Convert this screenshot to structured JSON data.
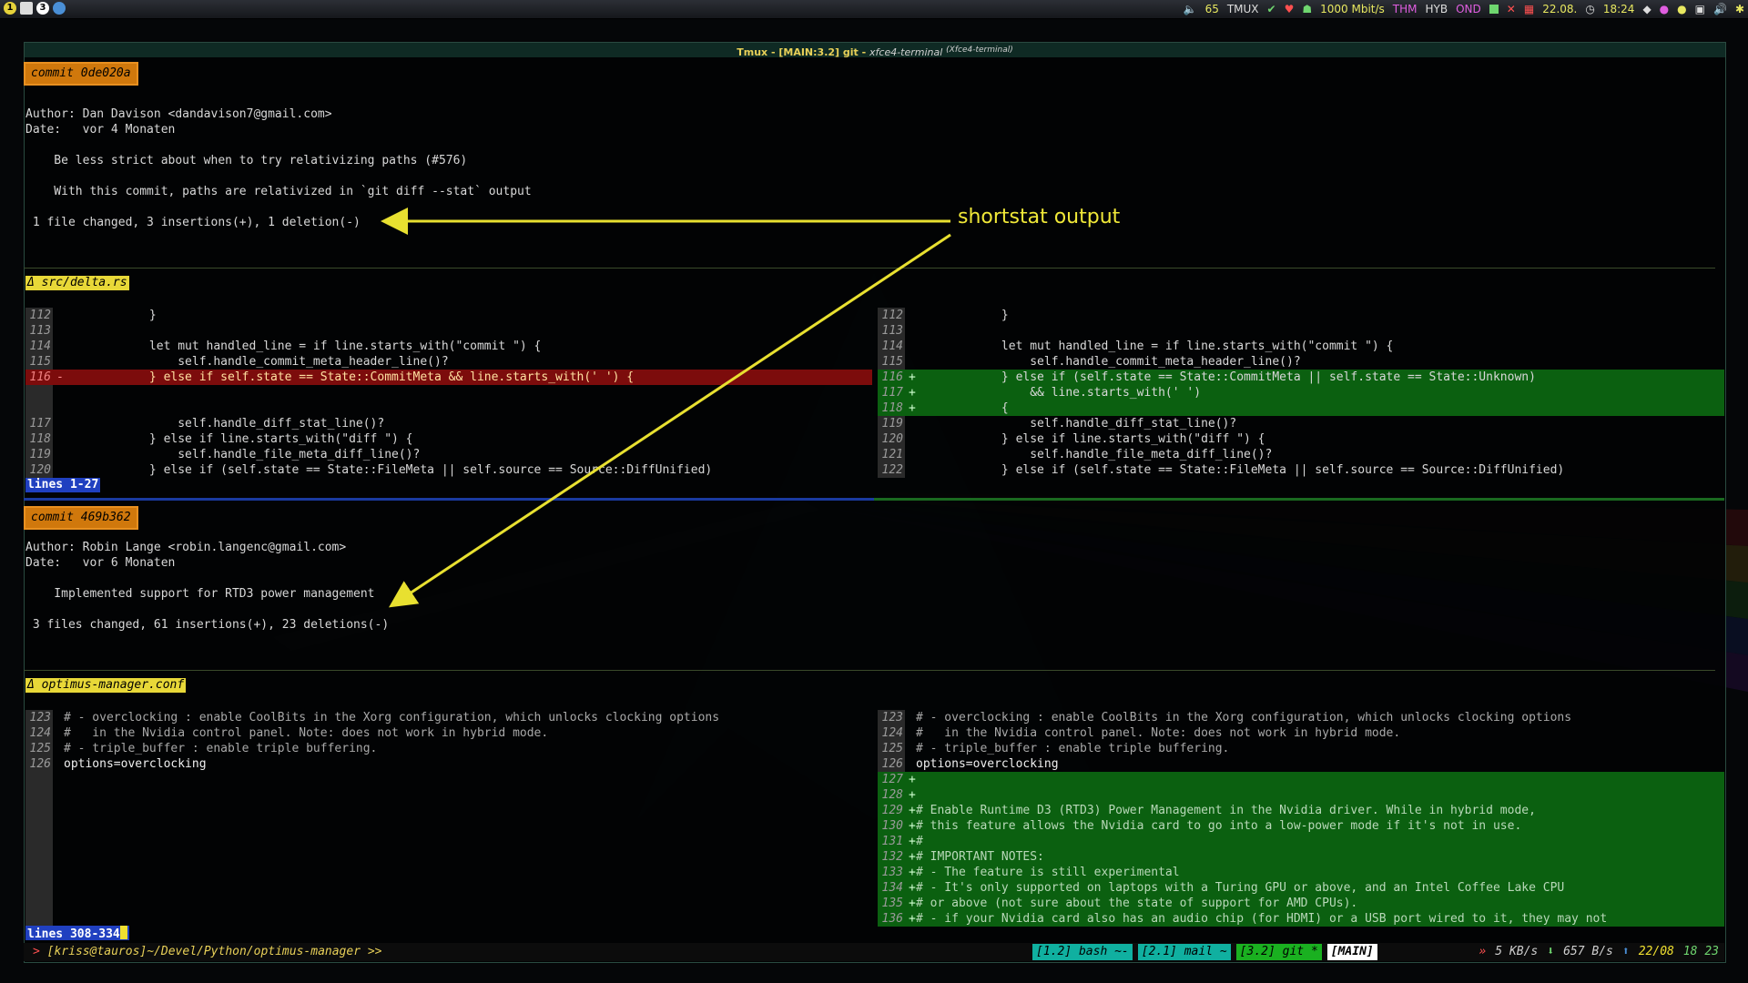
{
  "panel": {
    "workspaces": [
      "1",
      "",
      "3",
      ""
    ],
    "items": {
      "volume": "65",
      "tmux": "TMUX",
      "net": "1000 Mbit/s",
      "thm": "THM",
      "hyb": "HYB",
      "ond": "OND",
      "date": "22.08.",
      "time": "18:24"
    }
  },
  "window": {
    "title": "Tmux - [MAIN:3.2] git",
    "subtitle": "xfce4-terminal",
    "sup": "(Xfce4-terminal)"
  },
  "annotation": {
    "label": "shortstat output",
    "color": "#f0e838"
  },
  "commit1": {
    "hash": "commit 0de020a",
    "author": "Author: Dan Davison <dandavison7@gmail.com>",
    "date": "Date:   vor 4 Monaten",
    "message1": "    Be less strict about when to try relativizing paths (#576)",
    "message2": "    With this commit, paths are relativized in `git diff --stat` output",
    "shortstat": " 1 file changed, 3 insertions(+), 1 deletion(-)",
    "file": "Δ src/delta.rs",
    "left": [
      {
        "n": "112",
        "m": "",
        "c": "            }",
        "t": "n"
      },
      {
        "n": "113",
        "m": "",
        "c": "",
        "t": "n"
      },
      {
        "n": "114",
        "m": "",
        "c": "            let mut handled_line = if line.starts_with(\"commit \") {",
        "t": "n"
      },
      {
        "n": "115",
        "m": "",
        "c": "                self.handle_commit_meta_header_line()?",
        "t": "n"
      },
      {
        "n": "116",
        "m": "-",
        "c": "            } else if self.state == State::CommitMeta && line.starts_with(' ') {",
        "t": "d"
      },
      {
        "n": "",
        "m": "",
        "c": "",
        "t": "n"
      },
      {
        "n": "",
        "m": "",
        "c": "",
        "t": "n"
      },
      {
        "n": "117",
        "m": "",
        "c": "                self.handle_diff_stat_line()?",
        "t": "n"
      },
      {
        "n": "118",
        "m": "",
        "c": "            } else if line.starts_with(\"diff \") {",
        "t": "n"
      },
      {
        "n": "119",
        "m": "",
        "c": "                self.handle_file_meta_diff_line()?",
        "t": "n"
      },
      {
        "n": "120",
        "m": "",
        "c": "            } else if (self.state == State::FileMeta || self.source == Source::DiffUnified)",
        "t": "n"
      }
    ],
    "right": [
      {
        "n": "112",
        "m": "",
        "c": "            }",
        "t": "n"
      },
      {
        "n": "113",
        "m": "",
        "c": "",
        "t": "n"
      },
      {
        "n": "114",
        "m": "",
        "c": "            let mut handled_line = if line.starts_with(\"commit \") {",
        "t": "n"
      },
      {
        "n": "115",
        "m": "",
        "c": "                self.handle_commit_meta_header_line()?",
        "t": "n"
      },
      {
        "n": "116",
        "m": "+",
        "c": "            } else if (self.state == State::CommitMeta || self.state == State::Unknown)",
        "t": "a"
      },
      {
        "n": "117",
        "m": "+",
        "c": "                && line.starts_with(' ')",
        "t": "a"
      },
      {
        "n": "118",
        "m": "+",
        "c": "            {",
        "t": "a"
      },
      {
        "n": "119",
        "m": "",
        "c": "                self.handle_diff_stat_line()?",
        "t": "n"
      },
      {
        "n": "120",
        "m": "",
        "c": "            } else if line.starts_with(\"diff \") {",
        "t": "n"
      },
      {
        "n": "121",
        "m": "",
        "c": "                self.handle_file_meta_diff_line()?",
        "t": "n"
      },
      {
        "n": "122",
        "m": "",
        "c": "            } else if (self.state == State::FileMeta || self.source == Source::DiffUnified)",
        "t": "n"
      }
    ],
    "lines": "lines 1-27"
  },
  "commit2": {
    "hash": "commit 469b362",
    "author": "Author: Robin Lange <robin.langenc@gmail.com>",
    "date": "Date:   vor 6 Monaten",
    "message1": "    Implemented support for RTD3 power management",
    "shortstat": " 3 files changed, 61 insertions(+), 23 deletions(-)",
    "file": "Δ optimus-manager.conf",
    "left": [
      {
        "n": "123",
        "m": "",
        "c": "# - overclocking : enable CoolBits in the Xorg configuration, which unlocks clocking options",
        "t": "c"
      },
      {
        "n": "124",
        "m": "",
        "c": "#   in the Nvidia control panel. Note: does not work in hybrid mode.",
        "t": "c"
      },
      {
        "n": "125",
        "m": "",
        "c": "# - triple_buffer : enable triple buffering.",
        "t": "c"
      },
      {
        "n": "126",
        "m": "",
        "c": "options=overclocking",
        "t": "o"
      }
    ],
    "right": [
      {
        "n": "123",
        "m": "",
        "c": "# - overclocking : enable CoolBits in the Xorg configuration, which unlocks clocking options",
        "t": "c"
      },
      {
        "n": "124",
        "m": "",
        "c": "#   in the Nvidia control panel. Note: does not work in hybrid mode.",
        "t": "c"
      },
      {
        "n": "125",
        "m": "",
        "c": "# - triple_buffer : enable triple buffering.",
        "t": "c"
      },
      {
        "n": "126",
        "m": "",
        "c": "options=overclocking",
        "t": "o"
      },
      {
        "n": "127",
        "m": "+",
        "c": "",
        "t": "a"
      },
      {
        "n": "128",
        "m": "+",
        "c": "",
        "t": "a"
      },
      {
        "n": "129",
        "m": "+",
        "c": "# Enable Runtime D3 (RTD3) Power Management in the Nvidia driver. While in hybrid mode,",
        "t": "ac"
      },
      {
        "n": "130",
        "m": "+",
        "c": "# this feature allows the Nvidia card to go into a low-power mode if it's not in use.",
        "t": "ac"
      },
      {
        "n": "131",
        "m": "+",
        "c": "#",
        "t": "ac"
      },
      {
        "n": "132",
        "m": "+",
        "c": "# IMPORTANT NOTES:",
        "t": "ac"
      },
      {
        "n": "133",
        "m": "+",
        "c": "# - The feature is still experimental",
        "t": "ac"
      },
      {
        "n": "134",
        "m": "+",
        "c": "# - It's only supported on laptops with a Turing GPU or above, and an Intel Coffee Lake CPU",
        "t": "ac"
      },
      {
        "n": "135",
        "m": "+",
        "c": "# or above (not sure about the state of support for AMD CPUs).",
        "t": "ac"
      },
      {
        "n": "136",
        "m": "+",
        "c": "# - if your Nvidia card also has an audio chip (for HDMI) or a USB port wired to it, they may not",
        "t": "ac"
      }
    ],
    "lines": "lines 308-334"
  },
  "status": {
    "prompt": "[kriss@tauros]~/Devel/Python/optimus-manager >>",
    "prompt_arrow": ">",
    "windows": [
      "[1.2] bash ~-",
      "[2.1] mail ~",
      "[3.2] git *",
      "[MAIN]"
    ],
    "rate_down": "5 KB/s",
    "rate_up": "657 B/s",
    "date": "22/08",
    "time": "18 23"
  }
}
